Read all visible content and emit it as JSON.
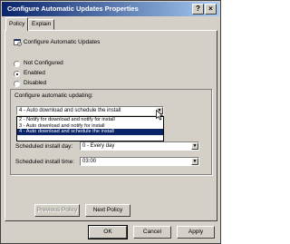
{
  "window": {
    "title": "Configure Automatic Updates Properties"
  },
  "controls": {
    "help_symbol": "?",
    "close_symbol": "×"
  },
  "tabs": [
    {
      "label": "Policy"
    },
    {
      "label": "Explain"
    }
  ],
  "policy": {
    "title": "Configure Automatic Updates"
  },
  "options": [
    {
      "label": "Not Configured",
      "selected": false
    },
    {
      "label": "Enabled",
      "selected": true
    },
    {
      "label": "Disabled",
      "selected": false
    }
  ],
  "group": {
    "label": "Configure automatic updating:",
    "combo_value": "4 - Auto download and schedule the install"
  },
  "dropdown": {
    "items": [
      "2 - Notify for download and notify for install",
      "3 - Auto download and notify for install",
      "4 - Auto download and schedule the install"
    ],
    "selected_index": 2
  },
  "schedule": {
    "day_label": "Scheduled install day:",
    "day_value": "0 - Every day",
    "time_label": "Scheduled install time:",
    "time_value": "03:00"
  },
  "nav": {
    "previous": "Previous Policy",
    "next": "Next Policy"
  },
  "footer": {
    "ok": "OK",
    "cancel": "Cancel",
    "apply": "Apply"
  },
  "colors": {
    "title_bar": "#0a246a",
    "face": "#d4d0c8",
    "highlight": "#0a246a"
  }
}
